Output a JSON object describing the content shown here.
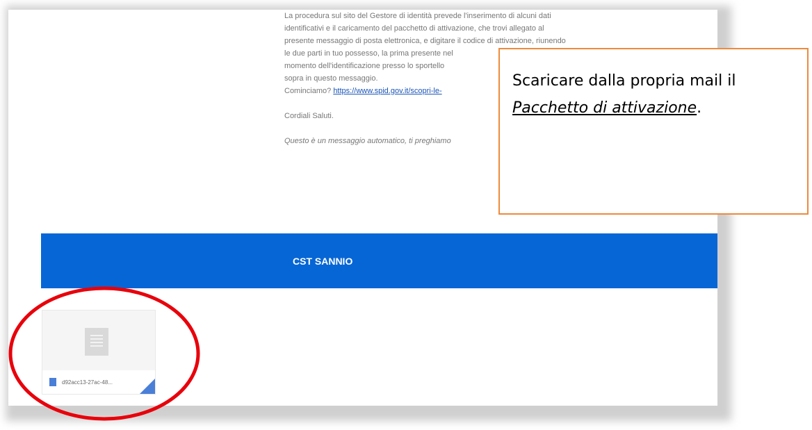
{
  "email": {
    "lines": [
      "La procedura sul sito del Gestore di identità prevede l'inserimento di alcuni dati",
      "identificativi e il caricamento del pacchetto di attivazione, che trovi allegato al",
      "presente messaggio di posta elettronica, e digitare il codice di attivazione, riunendo",
      "le due parti in tuo possesso, la prima presente nel",
      "momento dell'identificazione presso lo sportello",
      "sopra in questo messaggio."
    ],
    "link_prefix": "Cominciamo?",
    "link_text": "https://www.spid.gov.it/scopri-le-",
    "closing": "Cordiali Saluti.",
    "automatic_note": "Questo è un messaggio automatico, ti preghiamo"
  },
  "footer": {
    "brand": "CST SANNIO",
    "color": "#0766d6"
  },
  "attachment": {
    "filename": "d92acc13-27ac-48...",
    "icon": "document-icon"
  },
  "callout": {
    "text_before": "Scaricare dalla propria mail il ",
    "emphasis": "Pacchetto di attivazione",
    "text_after": ".",
    "border_color": "#ed8a3c"
  },
  "highlight": {
    "color": "#e8000b",
    "shape": "ellipse"
  }
}
